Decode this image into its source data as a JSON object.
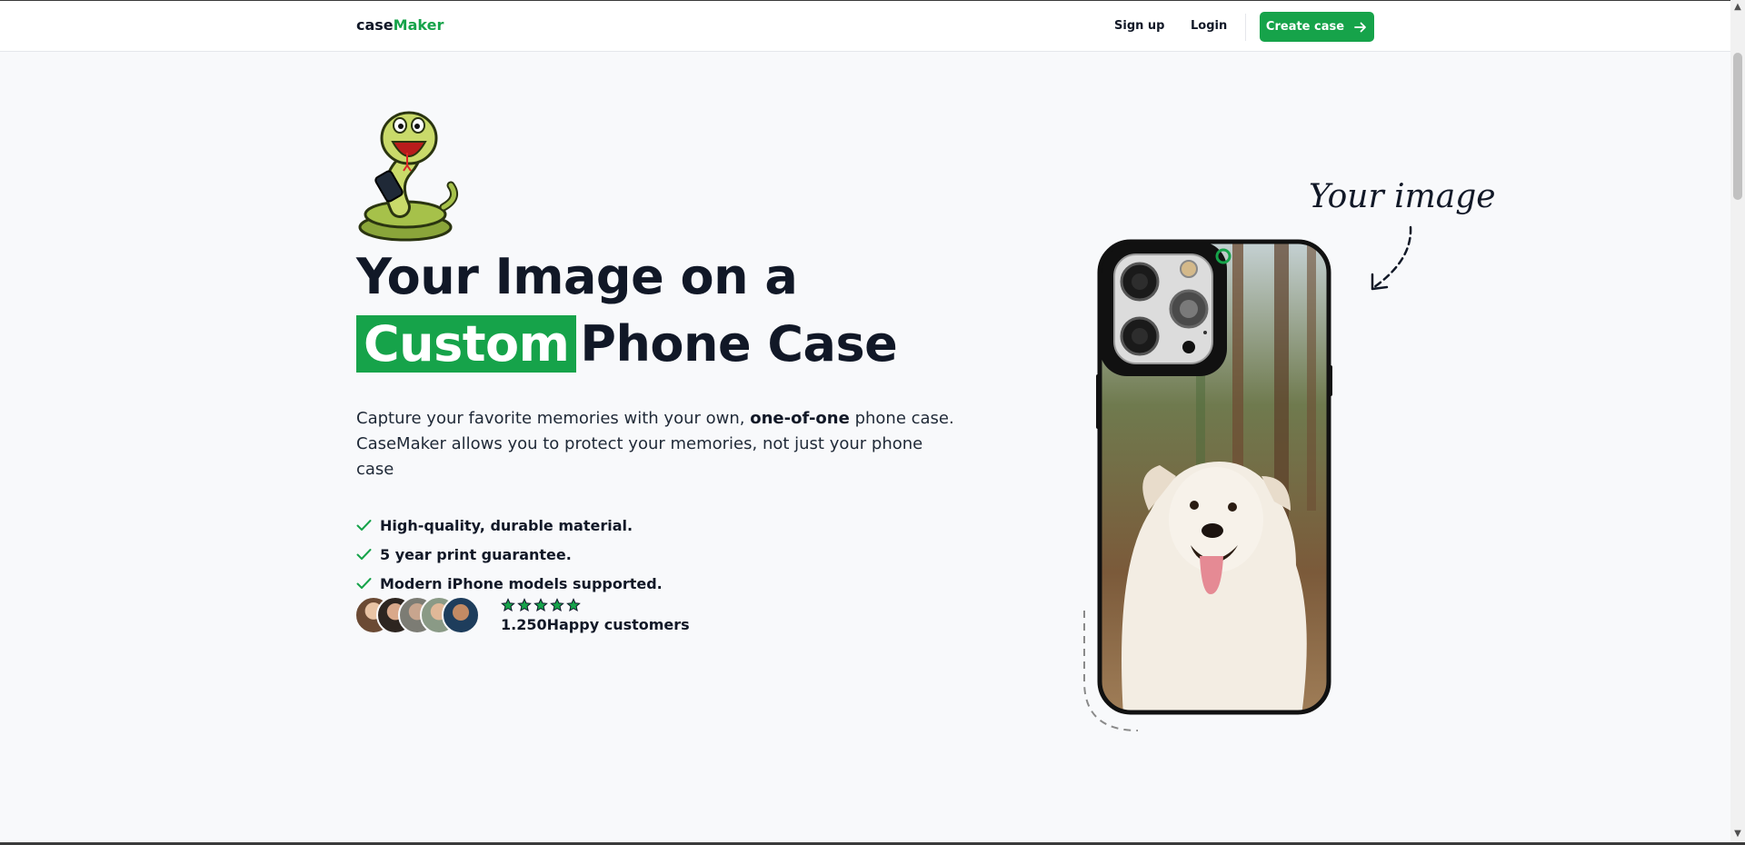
{
  "nav": {
    "logo_part1": "case",
    "logo_part2": "Maker",
    "signup": "Sign up",
    "login": "Login",
    "create_case": "Create case"
  },
  "hero": {
    "headline_line1": "Your Image on a",
    "headline_highlight": "Custom",
    "headline_rest": "Phone Case",
    "lead_start": "Capture your favorite memories with your own,",
    "lead_bold": "one-of-one",
    "lead_end": "phone case. CaseMaker allows you to protect your memories, not just your phone case",
    "features": [
      "High-quality, durable material.",
      "5 year print guarantee.",
      "Modern iPhone models supported."
    ],
    "rating_count": "1.250",
    "rating_label": "Happy customers",
    "stars": 5
  },
  "showcase": {
    "annotation": "Your image"
  },
  "colors": {
    "accent": "#16a34a",
    "text": "#111827",
    "background": "#f8f9fb"
  },
  "icons": [
    "check-icon",
    "arrow-right-icon",
    "star-icon",
    "mascot-snake",
    "curved-arrow-icon"
  ]
}
